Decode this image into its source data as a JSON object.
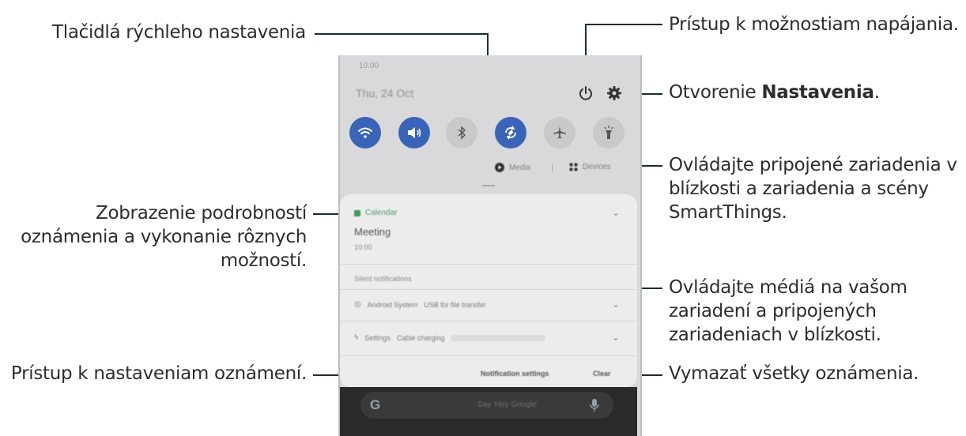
{
  "callouts": {
    "quick_buttons": "Tlačidlá rýchleho nastavenia",
    "power_options": "Prístup k možnostiam napájania.",
    "open_settings_prefix": "Otvorenie ",
    "open_settings_bold": "Nastavenia",
    "open_settings_suffix": ".",
    "smartthings_line1": "Ovládajte pripojené zariadenia v",
    "smartthings_line2": "blízkosti a zariadenia a scény",
    "smartthings_line3": "SmartThings.",
    "notif_details_line1": "Zobrazenie podrobností",
    "notif_details_line2": "oznámenia a vykonanie rôznych",
    "notif_details_line3": "možností.",
    "media_line1": "Ovládajte médiá na vašom",
    "media_line2": "zariadení a pripojených",
    "media_line3": "zariadeniach v blízkosti.",
    "notif_settings": "Prístup k nastaveniam oznámení.",
    "clear_all": "Vymazať všetky oznámenia."
  },
  "phone": {
    "status_time": "10:00",
    "date": "Thu, 24 Oct",
    "quick_settings": [
      {
        "icon": "wifi-icon",
        "state": "on"
      },
      {
        "icon": "sound-icon",
        "state": "on"
      },
      {
        "icon": "bluetooth-icon",
        "state": "off"
      },
      {
        "icon": "auto-rotate-icon",
        "state": "on"
      },
      {
        "icon": "airplane-icon",
        "state": "off"
      },
      {
        "icon": "flashlight-icon",
        "state": "off"
      }
    ],
    "media_label": "Media",
    "devices_label": "Devices",
    "calendar_app": "Calendar",
    "event_title": "Meeting",
    "event_time": "10:00",
    "silent_header": "Silent notifications",
    "android_app": "Android System",
    "android_text": "USB for file transfer",
    "settings_app": "Settings",
    "settings_text": "Cable charging",
    "notification_settings": "Notification settings",
    "clear": "Clear",
    "search_placeholder": "Say 'Hey Google'"
  },
  "colors": {
    "accent": "#3a64b8",
    "line": "#1c2b36",
    "calendar_green": "#3f9a5b"
  }
}
